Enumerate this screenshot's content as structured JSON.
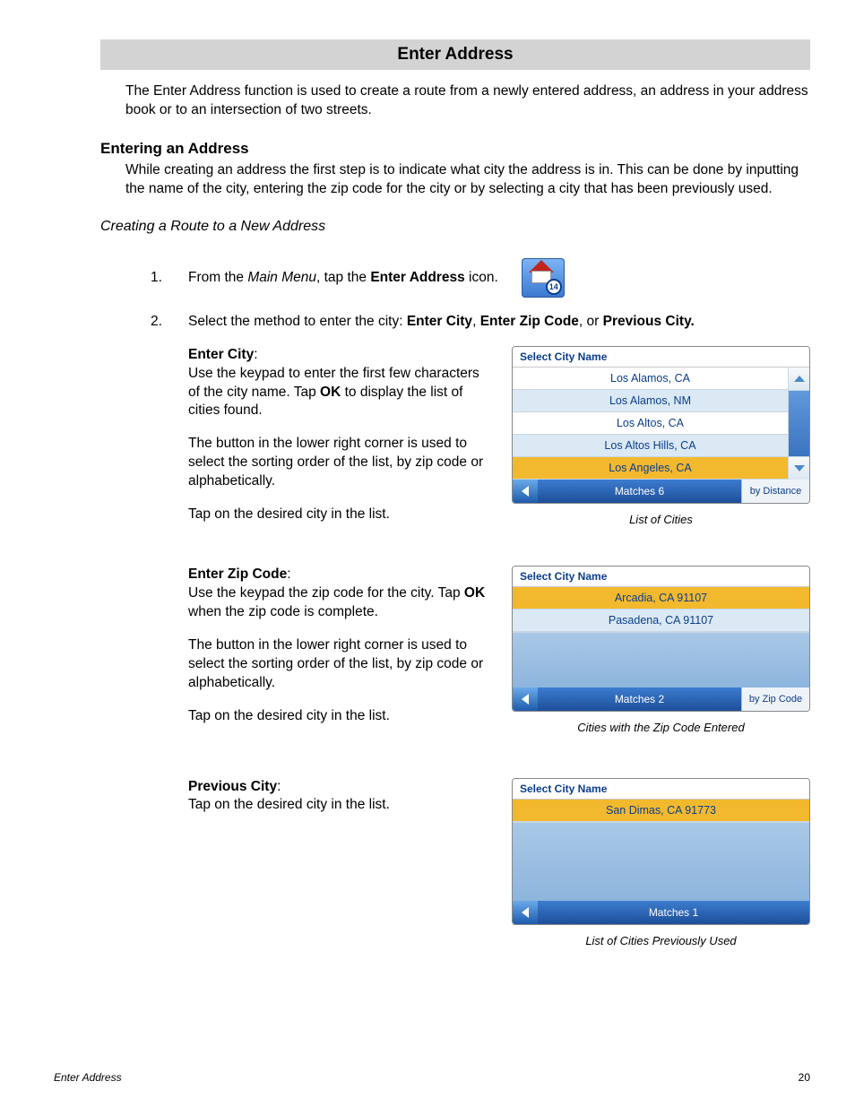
{
  "page": {
    "title": "Enter Address",
    "footer_left": "Enter Address",
    "footer_right": "20"
  },
  "intro": "The Enter Address function is used to create a route from a newly entered address, an address in your address book or to an intersection of two streets.",
  "h2": "Entering an Address",
  "h2_body": "While creating an address the first step is to indicate what city the address is in.  This can be done by inputting the name of the city, entering the zip code for the city or by selecting a city that has been previously used.",
  "h3": "Creating a Route to a New Address",
  "step1": {
    "num": "1.",
    "a": "From the ",
    "b": "Main Menu",
    "c": ", tap the ",
    "d": "Enter Address",
    "e": " icon.",
    "badge": "14"
  },
  "step2": {
    "num": "2.",
    "a": "Select the method to enter the city: ",
    "b": "Enter City",
    "c": ", ",
    "d": "Enter Zip Code",
    "e": ", or ",
    "f": "Previous City."
  },
  "sec1": {
    "head": "Enter City",
    "p1a": "Use the keypad to enter the first few characters of the city name.  Tap ",
    "p1b": "OK",
    "p1c": " to display the list of cities found.",
    "p2": "The button in the lower right corner is used to select the sorting order of the list, by zip code or alphabetically.",
    "p3": "Tap on the desired city in the list."
  },
  "shot1": {
    "title": "Select City Name",
    "rows": [
      "Los Alamos, CA",
      "Los Alamos, NM",
      "Los Altos, CA",
      "Los Altos Hills, CA",
      "Los Angeles, CA"
    ],
    "matches": "Matches  6",
    "sort": "by Distance",
    "caption": "List of Cities"
  },
  "sec2": {
    "head": "Enter Zip Code",
    "p1a": "Use the keypad the zip code for the city.  Tap ",
    "p1b": "OK",
    "p1c": " when the zip code is complete.",
    "p2": "The button in the lower right corner is used to select the sorting order of the list, by zip code or alphabetically.",
    "p3": "Tap on the desired city in the list."
  },
  "shot2": {
    "title": "Select City Name",
    "rows": [
      "Arcadia, CA 91107",
      "Pasadena, CA 91107"
    ],
    "matches": "Matches  2",
    "sort": "by Zip Code",
    "caption": "Cities with the Zip Code Entered"
  },
  "sec3": {
    "head": "Previous City",
    "p1": "Tap on the desired city in the list."
  },
  "shot3": {
    "title": "Select City Name",
    "rows": [
      "San Dimas, CA 91773"
    ],
    "matches": "Matches  1",
    "caption": "List of Cities Previously Used"
  }
}
